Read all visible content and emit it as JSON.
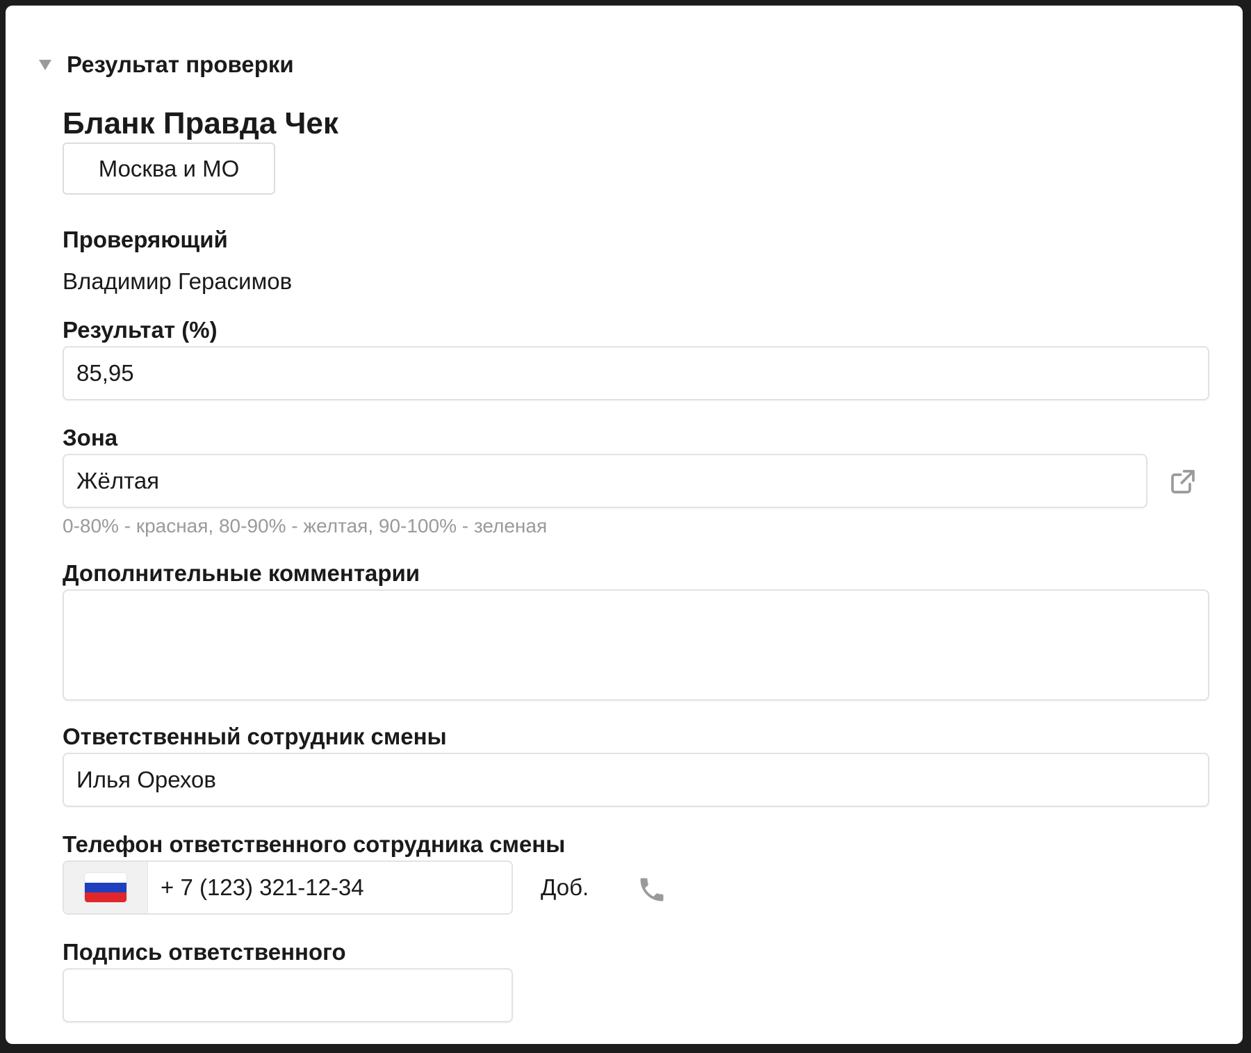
{
  "section": {
    "title": "Результат проверки"
  },
  "form": {
    "title": "Бланк Правда Чек",
    "region_label": "Москва и МО"
  },
  "inspector": {
    "label": "Проверяющий",
    "value": "Владимир Герасимов"
  },
  "result": {
    "label": "Результат (%)",
    "value": "85,95"
  },
  "zone": {
    "label": "Зона",
    "value": "Жёлтая",
    "hint": "0-80% - красная, 80-90% - желтая, 90-100% - зеленая",
    "icon": "external-link-icon"
  },
  "comments": {
    "label": "Дополнительные комментарии",
    "value": ""
  },
  "responsible": {
    "label": "Ответственный сотрудник смены",
    "value": "Илья Орехов"
  },
  "phone": {
    "label": "Телефон ответственного сотрудника смены",
    "value": "+ 7 (123) 321-12-34",
    "ext_label": "Доб.",
    "flag_icon": "russia-flag-icon",
    "call_icon": "phone-icon",
    "flag_colors": [
      "#ffffff",
      "#1f3fbf",
      "#e0262b"
    ]
  },
  "signature": {
    "label": "Подпись ответственного",
    "value": ""
  },
  "colors": {
    "hint_text": "#9a9a9a",
    "border": "#e2e2e2",
    "icon_gray": "#9a9a9a"
  }
}
